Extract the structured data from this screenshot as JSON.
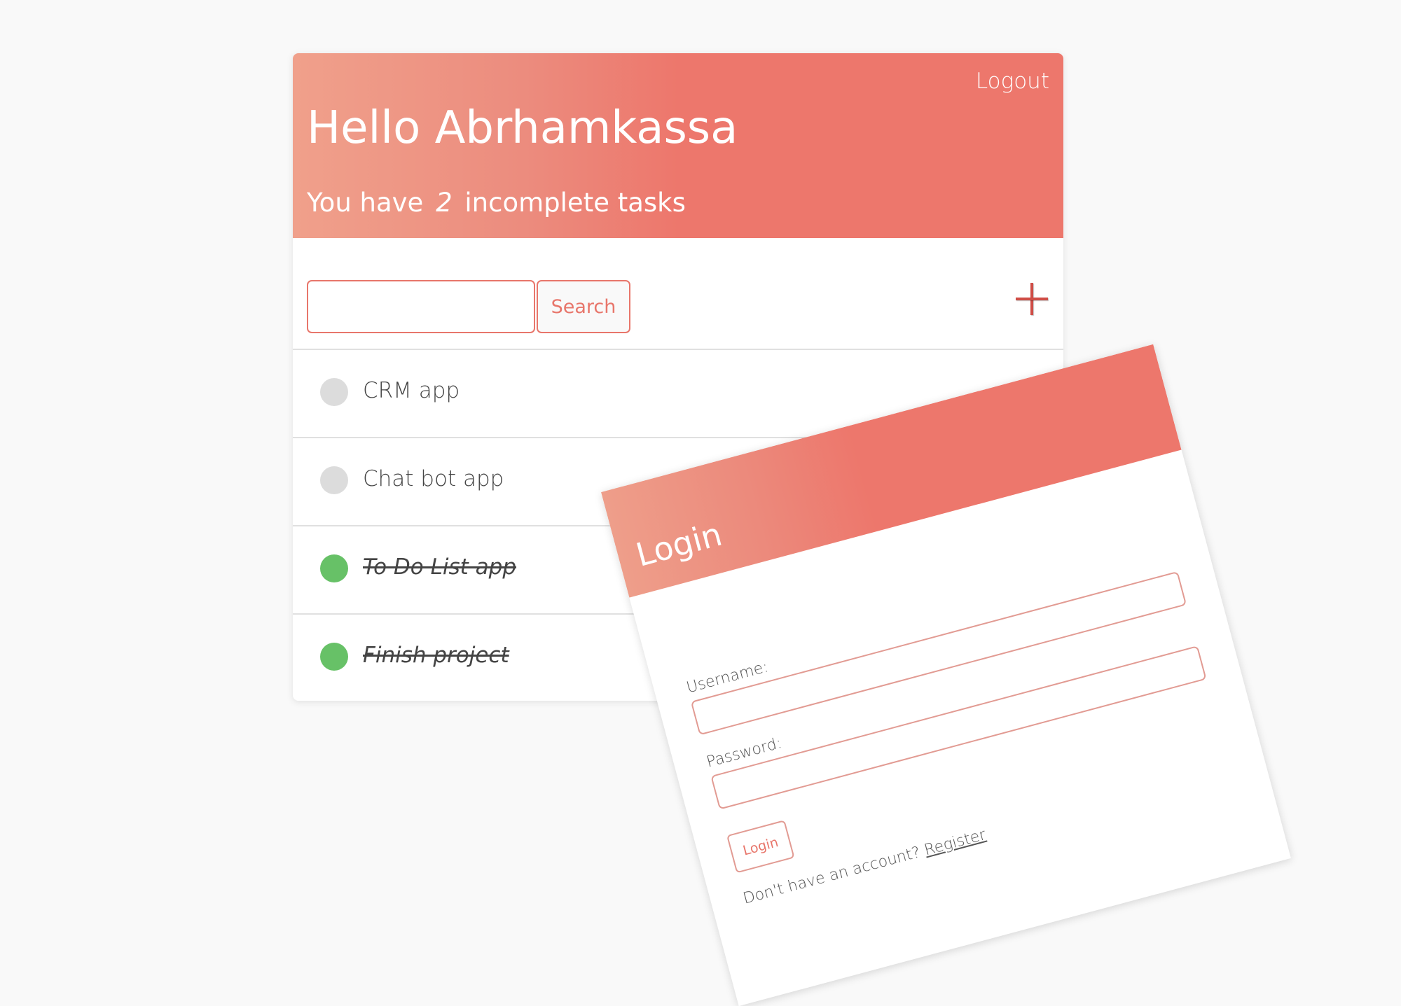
{
  "todo": {
    "logout_label": "Logout",
    "greeting": "Hello Abrhamkassa",
    "incomplete": {
      "prefix": "You have",
      "count": "2",
      "suffix": "incomplete tasks"
    },
    "search": {
      "value": "",
      "button_label": "Search"
    },
    "add_icon": "plus-icon",
    "delete_icon": "close-icon",
    "tasks": [
      {
        "label": "CRM app",
        "completed": false
      },
      {
        "label": "Chat bot app",
        "completed": false
      },
      {
        "label": "To Do List app",
        "completed": true
      },
      {
        "label": "Finish project",
        "completed": true
      }
    ]
  },
  "login": {
    "title": "Login",
    "username_label": "Username:",
    "username_value": "",
    "password_label": "Password:",
    "password_value": "",
    "button_label": "Login",
    "register_prompt": "Don't have an account?",
    "register_link": "Register"
  },
  "colors": {
    "accent": "#ed776c",
    "accent_light": "#f0a08b",
    "delete": "#cf4d46",
    "status_complete": "#67c167",
    "status_incomplete": "#dcdcdc",
    "background": "#f9f9f9"
  }
}
